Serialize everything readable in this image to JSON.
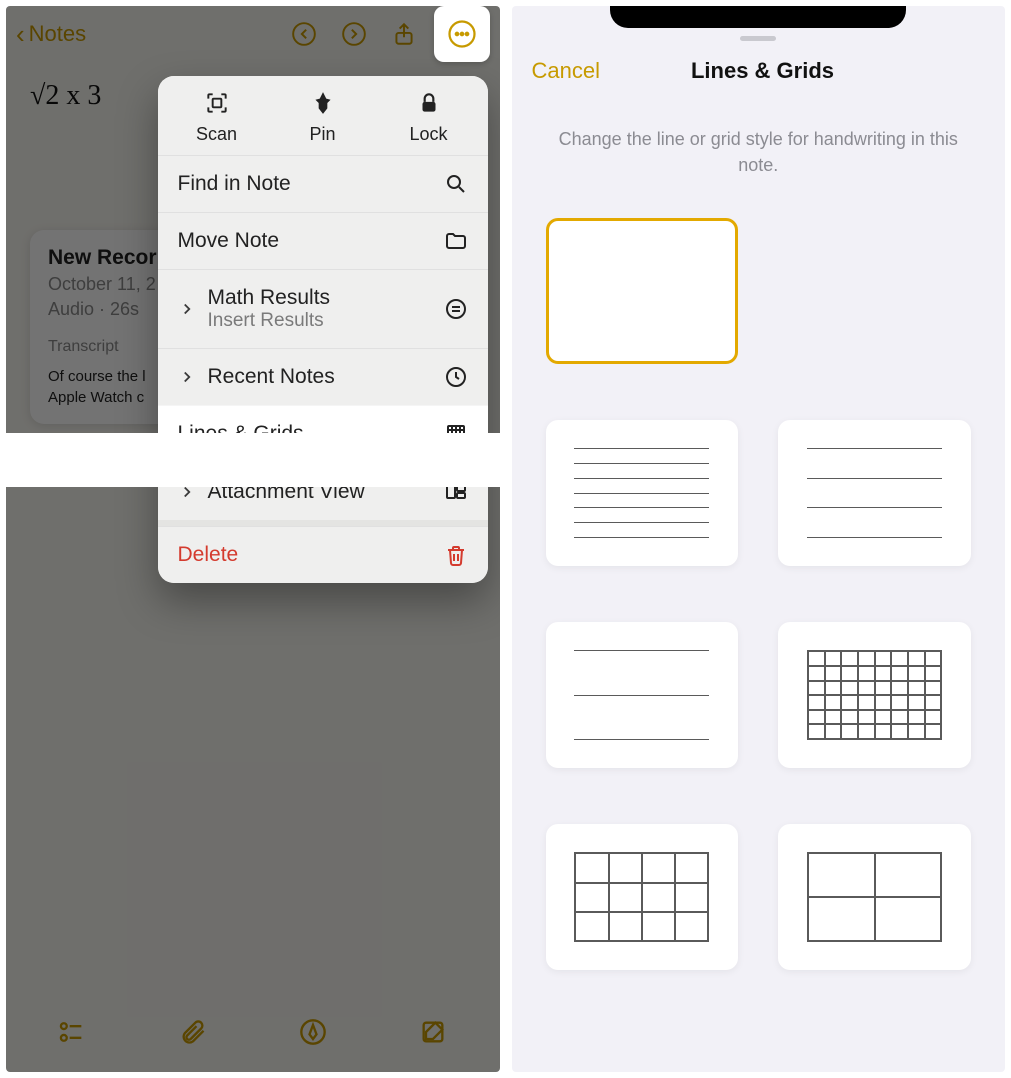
{
  "left": {
    "back_label": "Notes",
    "handwriting": "√2  x 3",
    "recording": {
      "title": "New Recor",
      "date": "October 11, 2",
      "duration": "Audio · 26s",
      "transcript_label": "Transcript",
      "preview": "Of course the l\nApple Watch c"
    },
    "menu": {
      "scan": "Scan",
      "pin": "Pin",
      "lock": "Lock",
      "find": "Find in Note",
      "move": "Move Note",
      "math_title": "Math Results",
      "math_sub": "Insert Results",
      "recent": "Recent Notes",
      "lines_grids": "Lines & Grids",
      "attachment": "Attachment View",
      "delete": "Delete"
    }
  },
  "right": {
    "cancel": "Cancel",
    "title": "Lines & Grids",
    "desc": "Change the line or grid style for handwriting in this note.",
    "selected_index": 0
  }
}
